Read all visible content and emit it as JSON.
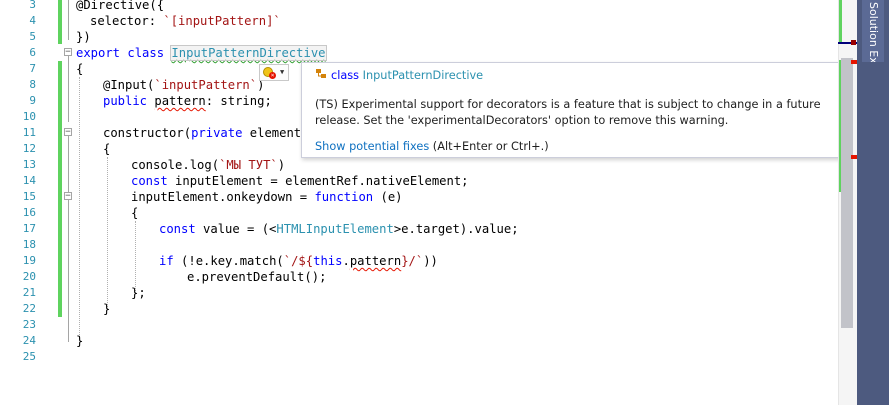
{
  "editor": {
    "line_numbers": [
      "3",
      "4",
      "5",
      "6",
      "7",
      "8",
      "9",
      "10",
      "11",
      "12",
      "13",
      "14",
      "15",
      "16",
      "17",
      "18",
      "19",
      "20",
      "21",
      "22",
      "23",
      "24",
      "25"
    ]
  },
  "code": {
    "l3": {
      "a": "@Directive({"
    },
    "l4": {
      "a": "selector: ",
      "b": "`[inputPattern]`"
    },
    "l5": {
      "a": "})"
    },
    "l6": {
      "kw1": "export",
      "kw2": "class",
      "name": "InputPatternDirective"
    },
    "l7": {
      "a": "{"
    },
    "l8": {
      "a": "@Input(",
      "b": "`inputPattern`",
      "c": ")"
    },
    "l9": {
      "kw": "public",
      "name": "pattern",
      "c": ": string;"
    },
    "l11": {
      "a": "constructor(",
      "kw": "private",
      "c": " elementRe"
    },
    "l12": {
      "a": "{"
    },
    "l13": {
      "a": "console.log(",
      "b": "`МЫ ТУТ`",
      "c": ")"
    },
    "l14": {
      "kw": "const",
      "c": " inputElement = elementRef.nativeElement;"
    },
    "l15": {
      "a": "inputElement.onkeydown = ",
      "kw": "function",
      "c": " (e)"
    },
    "l16": {
      "a": "{"
    },
    "l17": {
      "kw": "const",
      "a": " value = (<",
      "typ": "HTMLInputElement",
      "c": ">e.target).value;"
    },
    "l19": {
      "kw": "if",
      "a": " (!e.key.match(",
      "b1": "`/${",
      "kw2": "this",
      "c": ".",
      "name": "pattern",
      "b2": "}/`",
      "d": "))"
    },
    "l20": {
      "a": "e.preventDefault();"
    },
    "l21": {
      "a": "};"
    },
    "l22": {
      "a": "}"
    },
    "l24": {
      "a": "}"
    }
  },
  "quick_info": {
    "kind": "class",
    "name": "InputPatternDirective",
    "message": "(TS) Experimental support for decorators is a feature that is subject to change in a future release. Set the 'experimentalDecorators' option to remove this warning.",
    "fix_link": "Show potential fixes",
    "fix_shortcut": " (Alt+Enter or Ctrl+.)"
  },
  "side_panel": {
    "label": "Solution Explorer"
  },
  "colors": {
    "keyword": "#0000ff",
    "string": "#a31515",
    "type": "#2b91af",
    "line_number": "#2b91af",
    "change_bar": "#5fd35f",
    "error_squiggle": "#e51400",
    "link": "#0e70c0",
    "side_panel": "#4d5a7f"
  }
}
